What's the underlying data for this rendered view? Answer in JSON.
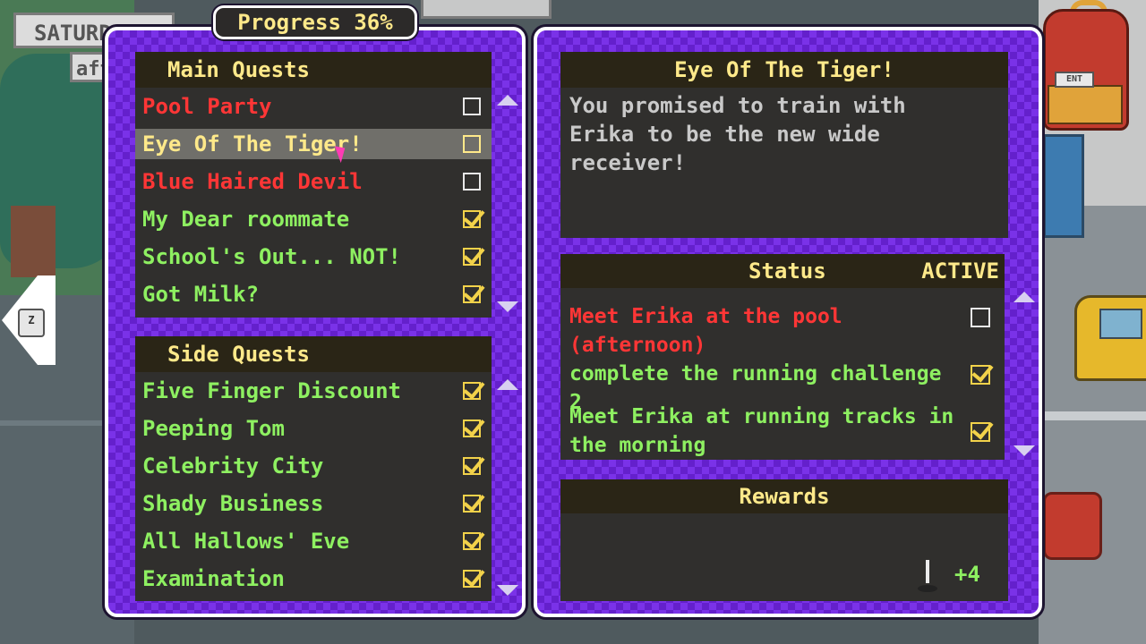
{
  "hud": {
    "day": "SATURDAY",
    "time": "aft"
  },
  "side_tab_key": "Z",
  "progress_label": "Progress 36%",
  "main_quests": {
    "title": "Main Quests",
    "items": [
      {
        "label": "Pool Party",
        "status": "active",
        "done": false
      },
      {
        "label": "Eye Of The Tiger!",
        "status": "selected",
        "done": false
      },
      {
        "label": "Blue Haired Devil",
        "status": "active",
        "done": false
      },
      {
        "label": "My Dear roommate",
        "status": "complete",
        "done": true
      },
      {
        "label": "School's Out... NOT!",
        "status": "complete",
        "done": true
      },
      {
        "label": "Got Milk?",
        "status": "complete",
        "done": true
      }
    ]
  },
  "side_quests": {
    "title": "Side Quests",
    "items": [
      {
        "label": "Five Finger Discount",
        "done": true
      },
      {
        "label": "Peeping Tom",
        "done": true
      },
      {
        "label": "Celebrity City",
        "done": true
      },
      {
        "label": "Shady Business",
        "done": true
      },
      {
        "label": "All Hallows' Eve",
        "done": true
      },
      {
        "label": "Examination",
        "done": true
      }
    ]
  },
  "detail": {
    "title": "Eye Of The Tiger!",
    "description": "You promised to train with Erika to be the new wide receiver!",
    "status_label": "Status",
    "status_value": "ACTIVE",
    "objectives": [
      {
        "text": "Meet Erika at the pool (afternoon)",
        "done": false
      },
      {
        "text": "complete the running challenge 2",
        "done": true
      },
      {
        "text": "Meet Erika at running tracks in the morning",
        "done": true
      }
    ],
    "rewards_label": "Rewards",
    "reward_value": "+4",
    "reward_icon": "joystick-icon"
  },
  "colors": {
    "active_quest": "#ff3636",
    "complete_quest": "#8ef061",
    "header_text": "#ffe98a",
    "panel_purple": "#7a32e8"
  }
}
